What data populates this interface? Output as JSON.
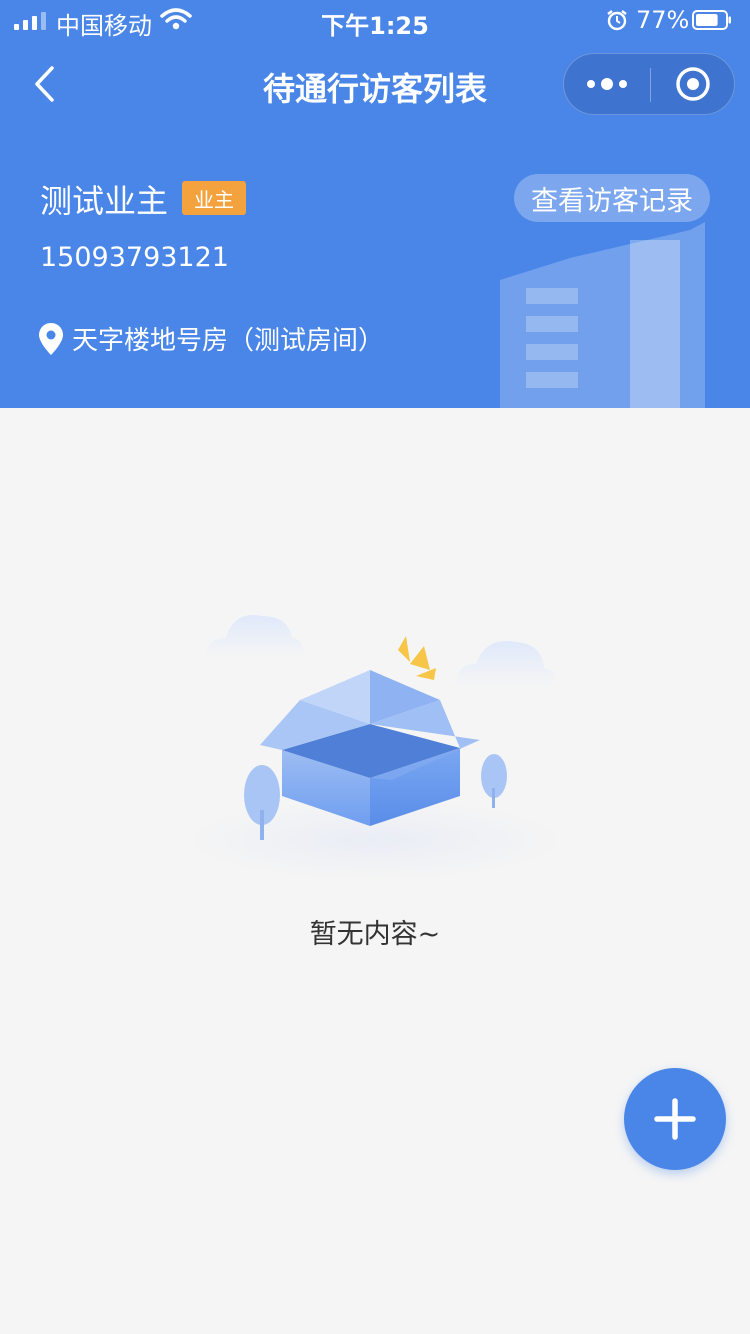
{
  "status_bar": {
    "carrier": "中国移动",
    "time": "下午1:25",
    "battery_percent": "77%",
    "battery_level": 0.77
  },
  "nav": {
    "title": "待通行访客列表",
    "back_icon": "chevron-left-icon",
    "more_icon": "more-dots-icon",
    "close_icon": "target-close-icon"
  },
  "user": {
    "name": "测试业主",
    "role_badge": "业主",
    "phone": "15093793121",
    "address": "天字楼地号房（测试房间）",
    "record_button": "查看访客记录"
  },
  "empty_state": {
    "text": "暂无内容~",
    "illustration": "empty-box-illustration"
  },
  "fab": {
    "icon": "plus-icon"
  },
  "colors": {
    "primary": "#4a86e8",
    "badge": "#f4a23e",
    "background": "#f5f5f5"
  }
}
